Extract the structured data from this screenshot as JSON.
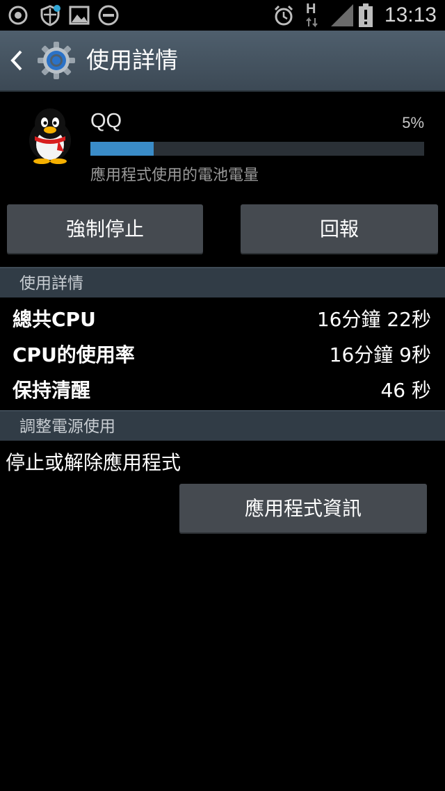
{
  "status_bar": {
    "time": "13:13",
    "network_letter": "H"
  },
  "action_bar": {
    "title": "使用詳情"
  },
  "app": {
    "name": "QQ",
    "battery_percent_label": "5%",
    "battery_fraction": 0.19,
    "subtitle": "應用程式使用的電池電量"
  },
  "buttons": {
    "force_stop": "強制停止",
    "report": "回報",
    "app_info": "應用程式資訊"
  },
  "sections": {
    "usage_details": "使用詳情",
    "adjust_power": "調整電源使用"
  },
  "usage_rows": [
    {
      "label": "總共CPU",
      "value": "16分鐘 22秒"
    },
    {
      "label": "CPU的使用率",
      "value": "16分鐘 9秒"
    },
    {
      "label": "保持清醒",
      "value": "46 秒"
    }
  ],
  "adjust": {
    "text": "停止或解除應用程式"
  },
  "colors": {
    "accent": "#3a8cc8",
    "action_bar": "#46525e",
    "button": "#454a50"
  }
}
